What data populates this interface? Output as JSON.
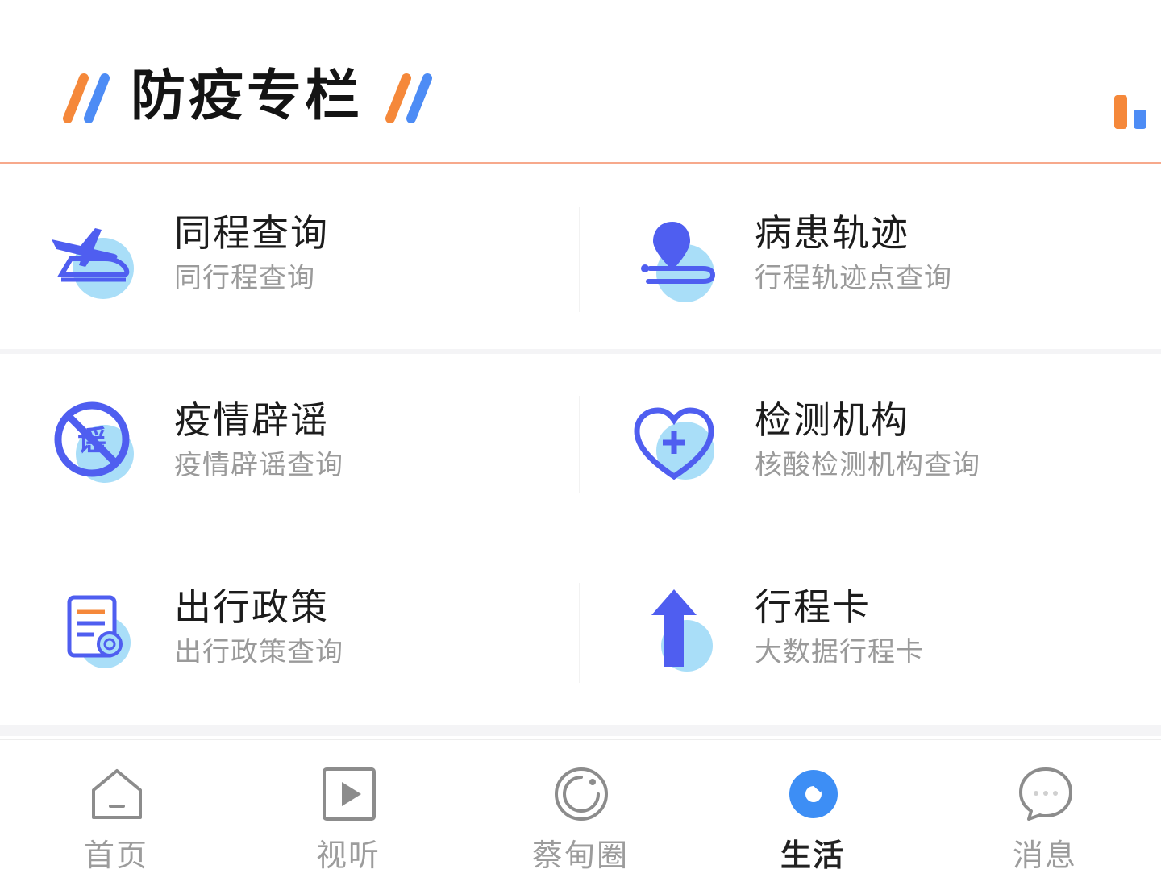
{
  "header": {
    "title": "防疫专栏",
    "left_decoration": "double-slash-icon",
    "right_decoration": "double-slash-icon",
    "stats_icon": "bar-chart-icon"
  },
  "colors": {
    "accent_orange": "#f5883a",
    "accent_blue": "#4d8cf5",
    "icon_primary": "#4f5ef0",
    "icon_secondary": "#9fd8f7",
    "tab_active": "#3d8ef5"
  },
  "services": [
    {
      "title": "同程查询",
      "subtitle": "同行程查询",
      "icon": "train-plane-icon"
    },
    {
      "title": "病患轨迹",
      "subtitle": "行程轨迹点查询",
      "icon": "location-pin-icon"
    },
    {
      "title": "疫情辟谣",
      "subtitle": "疫情辟谣查询",
      "icon": "no-rumor-icon"
    },
    {
      "title": "检测机构",
      "subtitle": "核酸检测机构查询",
      "icon": "heart-plus-icon"
    },
    {
      "title": "出行政策",
      "subtitle": "出行政策查询",
      "icon": "policy-document-icon"
    },
    {
      "title": "行程卡",
      "subtitle": "大数据行程卡",
      "icon": "up-arrow-icon"
    }
  ],
  "tabbar": {
    "items": [
      {
        "label": "首页",
        "icon": "home-icon",
        "active": false
      },
      {
        "label": "视听",
        "icon": "play-icon",
        "active": false
      },
      {
        "label": "蔡甸圈",
        "icon": "circle-icon",
        "active": false
      },
      {
        "label": "生活",
        "icon": "life-icon",
        "active": true
      },
      {
        "label": "消息",
        "icon": "chat-bubble-icon",
        "active": false
      }
    ]
  }
}
